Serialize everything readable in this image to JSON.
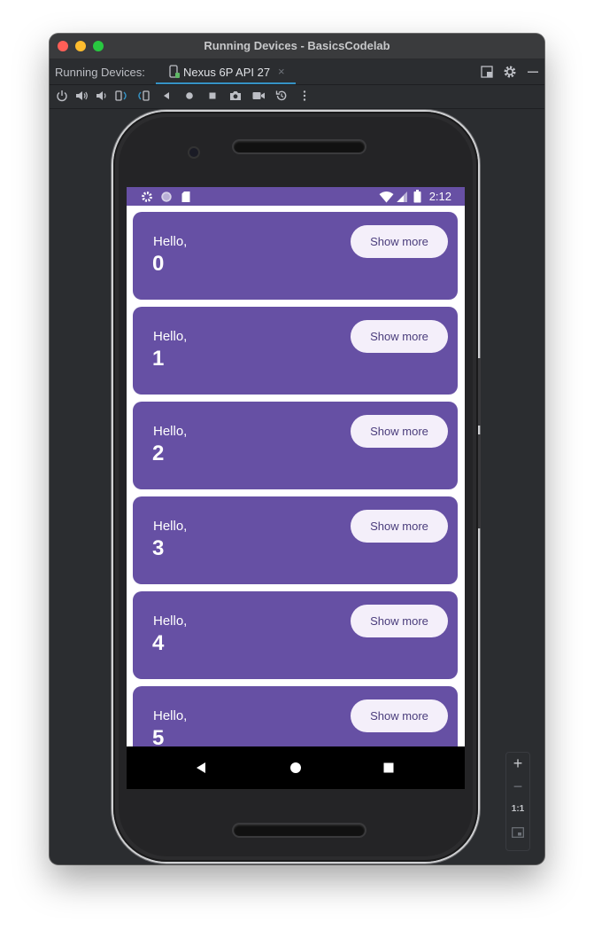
{
  "window": {
    "title": "Running Devices - BasicsCodelab"
  },
  "tabbar": {
    "label": "Running Devices:",
    "tab": {
      "label": "Nexus 6P API 27",
      "close": "×",
      "icon": "phone-device-icon"
    },
    "right_icons": [
      "restore-layout-icon",
      "gear-icon",
      "minimize-icon"
    ]
  },
  "toolbar": {
    "icons": [
      "power-icon",
      "volume-up-icon",
      "volume-down-icon",
      "rotate-left-icon",
      "rotate-right-icon",
      "back-icon",
      "home-icon",
      "overview-icon",
      "camera-icon",
      "record-icon",
      "reset-icon",
      "more-icon"
    ]
  },
  "status_bar": {
    "time": "2:12",
    "left_icons": [
      "gear-icon",
      "circle-icon",
      "sd-card-icon"
    ],
    "right_icons": [
      "wifi-icon",
      "signal-icon",
      "battery-icon"
    ]
  },
  "cards": [
    {
      "greeting": "Hello,",
      "number": "0",
      "button": "Show more"
    },
    {
      "greeting": "Hello,",
      "number": "1",
      "button": "Show more"
    },
    {
      "greeting": "Hello,",
      "number": "2",
      "button": "Show more"
    },
    {
      "greeting": "Hello,",
      "number": "3",
      "button": "Show more"
    },
    {
      "greeting": "Hello,",
      "number": "4",
      "button": "Show more"
    },
    {
      "greeting": "Hello,",
      "number": "5",
      "button": "Show more"
    }
  ],
  "nav_bar": {
    "icons": [
      "back-triangle-icon",
      "home-circle-icon",
      "recents-square-icon"
    ]
  },
  "zoom_panel": {
    "zoom_in": "+",
    "zoom_out": "−",
    "actual_size": "1:1",
    "fit_icon": "fit-screen-icon"
  },
  "colors": {
    "card": "#6650a4",
    "status_bar": "#6750a4",
    "button_bg": "#f4effa",
    "button_text": "#4a3d7c",
    "ide_bg": "#2b2d30",
    "tab_underline": "#3592c4"
  }
}
